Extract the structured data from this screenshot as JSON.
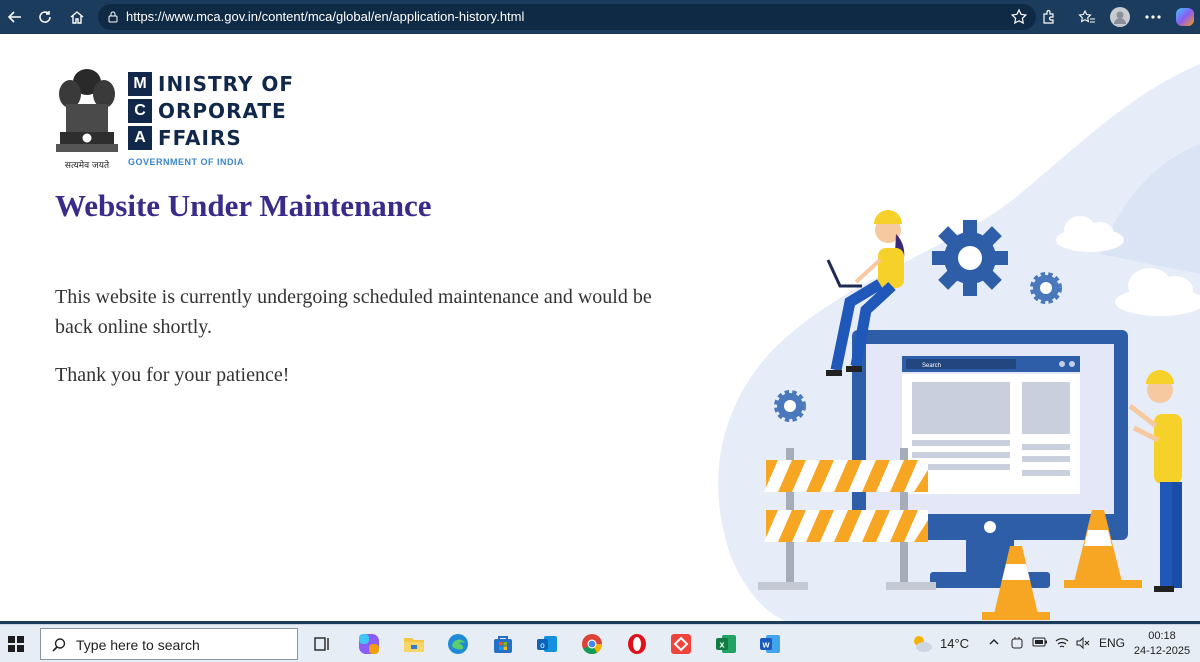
{
  "browser": {
    "url": "https://www.mca.gov.in/content/mca/global/en/application-history.html",
    "colors": {
      "toolbar": "#1c3c5e",
      "urlbox": "#0f2a45"
    }
  },
  "logo": {
    "letters": [
      "M",
      "C",
      "A"
    ],
    "words": [
      "INISTRY OF",
      "ORPORATE",
      "FFAIRS"
    ],
    "subtitle": "GOVERNMENT OF INDIA",
    "emblem_caption": "सत्यमेव जयते"
  },
  "page": {
    "title": "Website Under Maintenance",
    "message": "This website is currently undergoing scheduled maintenance and would be back online shortly.",
    "thanks": "Thank you for your patience!",
    "illustration_search_label": "Search",
    "colors": {
      "title": "#3a2a8a",
      "text": "#333333",
      "brand": "#12284a",
      "accent": "#3b86c8"
    }
  },
  "taskbar": {
    "search_placeholder": "Type here to search",
    "weather": "14°C",
    "language": "ENG",
    "time": "00:18",
    "date": "24-12-2025",
    "apps": [
      "task-view",
      "copilot",
      "file-explorer",
      "edge",
      "store",
      "outlook",
      "chrome",
      "opera",
      "anydesk",
      "excel",
      "word"
    ]
  }
}
